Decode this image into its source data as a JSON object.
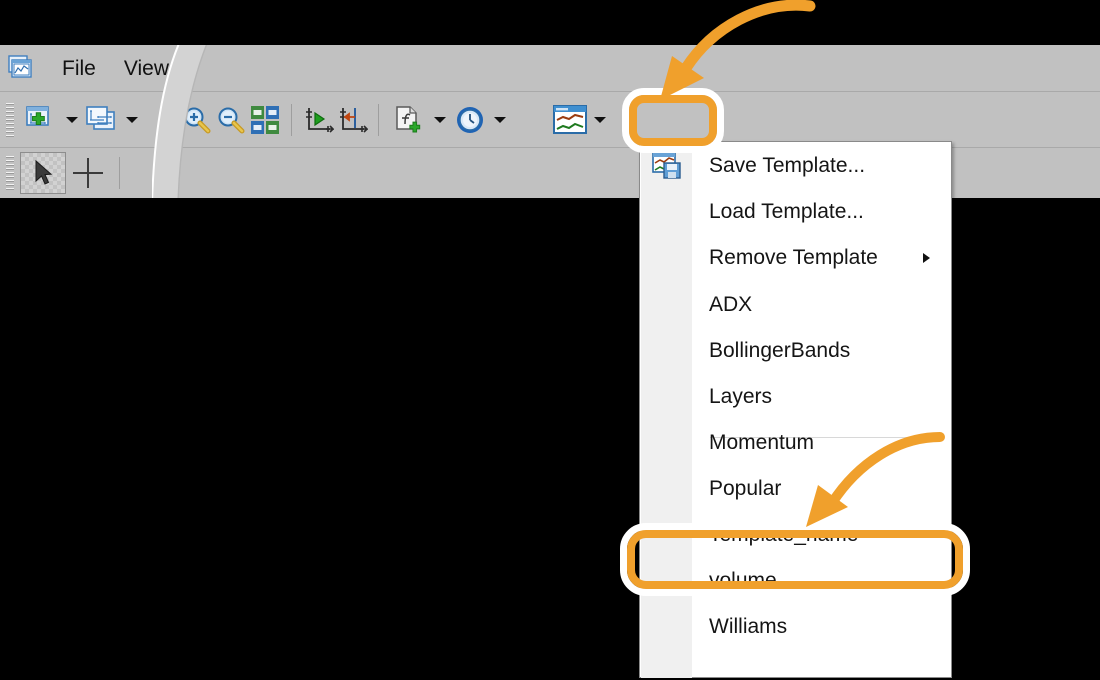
{
  "window": {
    "app_logo_icon": "chart-document-icon",
    "menubar": [
      {
        "label": "File",
        "name": "menu-file"
      },
      {
        "label": "View",
        "name": "menu-view"
      }
    ]
  },
  "toolbar_row_1": {
    "items": [
      {
        "name": "add-graph-button",
        "icon": "add-graph-icon",
        "has_dropdown": true
      },
      {
        "name": "arrange-layers-button",
        "icon": "arrange-layers-icon",
        "has_dropdown": true
      },
      {
        "name": "zoom-in-button",
        "icon": "zoom-in-icon",
        "has_dropdown": false
      },
      {
        "name": "zoom-out-button",
        "icon": "zoom-out-icon",
        "has_dropdown": false
      },
      {
        "name": "tile-windows-button",
        "icon": "tile-windows-icon",
        "has_dropdown": false
      },
      {
        "name": "axis-start-button",
        "icon": "axis-play-icon",
        "has_dropdown": false
      },
      {
        "name": "axis-marker-button",
        "icon": "axis-marker-icon",
        "has_dropdown": false
      },
      {
        "name": "new-function-button",
        "icon": "new-function-icon",
        "has_dropdown": true
      },
      {
        "name": "period-clock-button",
        "icon": "clock-icon",
        "has_dropdown": true
      },
      {
        "name": "templates-button",
        "icon": "chart-template-icon",
        "has_dropdown": true
      }
    ]
  },
  "toolbar_row_2": {
    "items": [
      {
        "name": "cursor-tool-button",
        "icon": "arrow-cursor-icon",
        "selected": true
      },
      {
        "name": "crosshair-tool-button",
        "icon": "crosshair-icon",
        "selected": false
      }
    ]
  },
  "template_menu": {
    "name": "templates-dropdown-menu",
    "items": [
      {
        "label": "Save Template...",
        "name": "menu-item-save-template",
        "icon": "save-template-icon",
        "submenu": false,
        "highlighted": false
      },
      {
        "label": "Load Template...",
        "name": "menu-item-load-template",
        "icon": "",
        "submenu": false,
        "highlighted": false
      },
      {
        "label": "Remove Template",
        "name": "menu-item-remove-template",
        "icon": "",
        "submenu": true,
        "highlighted": false
      },
      {
        "label": "ADX",
        "name": "menu-item-adx",
        "icon": "",
        "submenu": false,
        "highlighted": false
      },
      {
        "label": "BollingerBands",
        "name": "menu-item-bollingerbands",
        "icon": "",
        "submenu": false,
        "highlighted": false
      },
      {
        "label": "Layers",
        "name": "menu-item-layers",
        "icon": "",
        "submenu": false,
        "highlighted": false
      },
      {
        "label": "Momentum",
        "name": "menu-item-momentum",
        "icon": "",
        "submenu": false,
        "highlighted": false
      },
      {
        "label": "Popular",
        "name": "menu-item-popular",
        "icon": "",
        "submenu": false,
        "highlighted": false
      },
      {
        "label": "Template_name",
        "name": "menu-item-template-name",
        "icon": "",
        "submenu": false,
        "highlighted": true
      },
      {
        "label": "volume",
        "name": "menu-item-volume",
        "icon": "",
        "submenu": false,
        "highlighted": false
      },
      {
        "label": "Williams",
        "name": "menu-item-williams",
        "icon": "",
        "submenu": false,
        "highlighted": false
      }
    ]
  },
  "annotations": {
    "highlight_color": "#f0a02c",
    "outline_color": "#ffffff",
    "callouts": [
      {
        "name": "highlight-ring-templates-button",
        "target": "templates-button"
      },
      {
        "name": "highlight-ring-template-name",
        "target": "menu-item-template-name"
      },
      {
        "name": "arrow-to-templates-button",
        "target": "templates-button"
      },
      {
        "name": "arrow-to-template-name",
        "target": "menu-item-template-name"
      }
    ]
  }
}
